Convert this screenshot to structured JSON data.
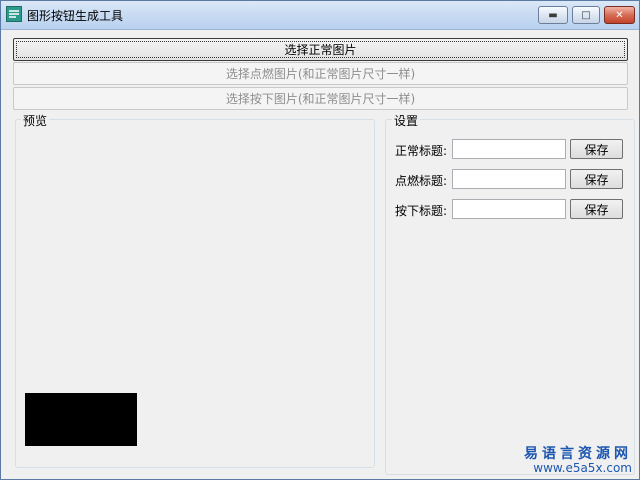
{
  "window": {
    "title": "图形按钮生成工具",
    "controls": {
      "minimize_icon": "minimize-icon",
      "maximize_icon": "maximize-icon",
      "close_icon": "close-icon"
    }
  },
  "buttons": {
    "select_normal": "选择正常图片",
    "select_hover": "选择点燃图片(和正常图片尺寸一样)",
    "select_pressed": "选择按下图片(和正常图片尺寸一样)"
  },
  "preview": {
    "label": "预览",
    "swatch_color": "#000000"
  },
  "settings": {
    "label": "设置",
    "rows": [
      {
        "label": "正常标题:",
        "value": "",
        "save": "保存"
      },
      {
        "label": "点燃标题:",
        "value": "",
        "save": "保存"
      },
      {
        "label": "按下标题:",
        "value": "",
        "save": "保存"
      }
    ]
  },
  "watermark": {
    "text": "易语言资源网",
    "url": "www.e5a5x.com"
  },
  "colors": {
    "title_bar": "#c9dcf3",
    "close_button": "#c3432b",
    "watermark": "#1d57b0"
  }
}
